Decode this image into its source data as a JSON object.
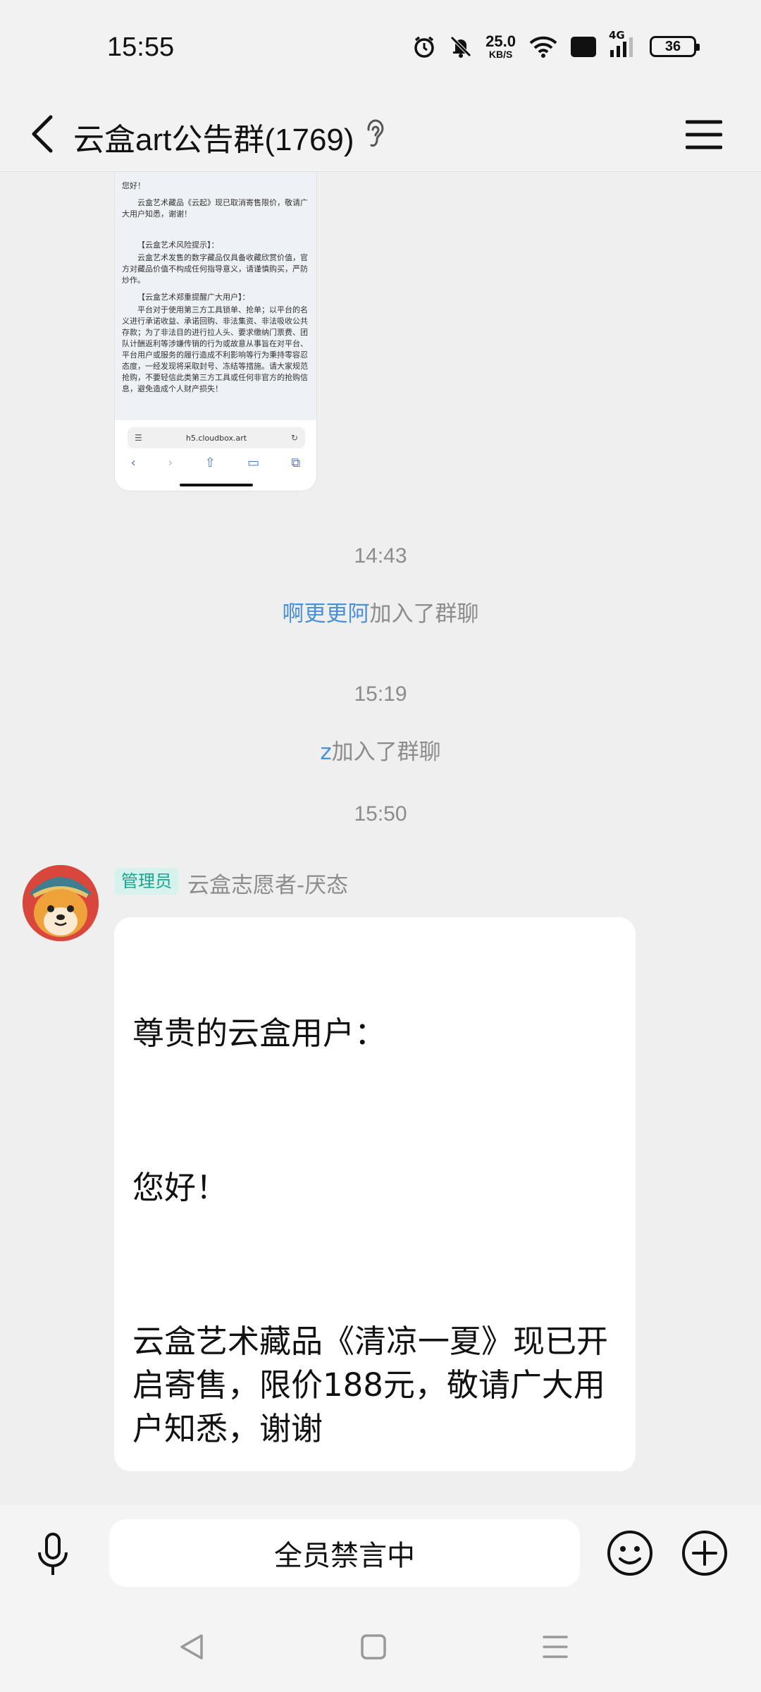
{
  "status_bar": {
    "time": "15:55",
    "net_speed_value": "25.0",
    "net_speed_unit": "KB/S",
    "hd_label": "HD",
    "signal_label": "4G",
    "battery_level": "36",
    "icons": [
      "alarm-icon",
      "mute-bell-icon",
      "wifi-icon",
      "signal-icon",
      "battery-icon"
    ]
  },
  "header": {
    "title": "云盒art公告群(1769)",
    "icons": [
      "back-arrow-icon",
      "ear-icon",
      "menu-icon"
    ]
  },
  "shared_screenshot": {
    "lines": [
      "您好！",
      "云盒艺术藏品《云起》现已取消寄售限价，敬请广大用户知悉，谢谢！",
      "【云盒艺术风险提示】：",
      "云盒艺术发售的数字藏品仅具备收藏欣赏价值，官方对藏品价值不构成任何指导意义，请谨慎购买，严防炒作。",
      "【云盒艺术郑重提醒广大用户】：",
      "平台对于使用第三方工具锁单、抢单；以平台的名义进行承诺收益、承诺回购、非法集资、非法吸收公共存款；为了非法目的进行拉人头、要求缴纳门票费、团队计酬返利等涉嫌传销的行为或故意从事旨在对平台、平台用户或服务的履行造成不利影响等行为秉持零容忍态度，一经发现将采取封号、冻结等措施。请大家规范抢购，不要轻信此类第三方工具或任何非官方的抢购信息，避免造成个人财产损失！"
    ],
    "url": "h5.cloudbox.art"
  },
  "messages": {
    "time1": "14:43",
    "join1_user": "啊更更阿",
    "join1_text": "加入了群聊",
    "time2": "15:19",
    "join2_user": "z",
    "join2_text": "加入了群聊",
    "time3": "15:50",
    "admin_badge": "管理员",
    "sender": "云盒志愿者-厌态",
    "bubble": {
      "line1": "尊贵的云盒用户：",
      "line2": "您好！",
      "line3a": "云盒艺术藏品《清凉一夏》现已开",
      "line3b": "启寄售，限价188元，敬请广大用",
      "line3c": "户知悉，谢谢"
    }
  },
  "input_bar": {
    "muted_text": "全员禁言中",
    "icons": [
      "microphone-icon",
      "emoji-icon",
      "plus-icon"
    ]
  },
  "nav_bar": {
    "icons": [
      "nav-back-icon",
      "nav-home-icon",
      "nav-recents-icon"
    ]
  },
  "colors": {
    "background": "#efefef",
    "link_blue": "#4a90d9",
    "admin_badge_bg": "#d7f1ec",
    "admin_badge_text": "#18a58f",
    "muted_gray": "#8c8c8c"
  }
}
